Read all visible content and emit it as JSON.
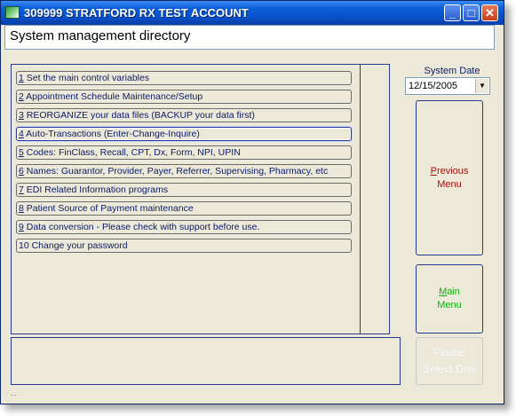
{
  "window": {
    "title": "309999 STRATFORD RX TEST ACCOUNT"
  },
  "titlebar_buttons": {
    "minimize": "_",
    "maximize": "□",
    "close": "✕"
  },
  "header": {
    "title": "System management directory"
  },
  "menu_items": [
    {
      "key": "1",
      "rest": " Set the main control variables"
    },
    {
      "key": "2",
      "rest": " Appointment Schedule Maintenance/Setup"
    },
    {
      "key": "3",
      "rest": " REORGANIZE your data files (BACKUP your data first)"
    },
    {
      "key": "4",
      "rest": " Auto-Transactions (Enter-Change-Inquire)"
    },
    {
      "key": "5",
      "rest": " Codes: FinClass, Recall, CPT, Dx, Form, NPI, UPIN"
    },
    {
      "key": "6",
      "rest": " Names: Guarantor, Provider, Payer, Referrer, Supervising, Pharmacy, etc"
    },
    {
      "key": "7",
      "rest": " EDI Related Information programs"
    },
    {
      "key": "8",
      "rest": " Patient Source of Payment maintenance"
    },
    {
      "key": "9",
      "rest": " Data conversion - Please check with support before use."
    },
    {
      "key": "",
      "rest": "10 Change your password"
    }
  ],
  "system_date": {
    "label": "System Date",
    "value": "12/15/2005"
  },
  "buttons": {
    "previous_first": "P",
    "previous_rest": "revious",
    "previous_line2": "Menu",
    "main_first": "M",
    "main_rest": "ain",
    "main_line2": "Menu",
    "please_line1": "Please",
    "please_line2": "Select One"
  },
  "status": {
    "dots": ".."
  },
  "colors": {
    "titlebar": "#0a5fd8",
    "window_bg": "#ece9d8",
    "previous_text": "#a01010",
    "main_text": "#10b010"
  }
}
